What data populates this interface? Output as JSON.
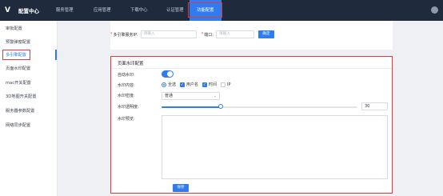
{
  "app": {
    "title": "配置中心"
  },
  "nav": {
    "items": [
      {
        "label": "服务管理"
      },
      {
        "label": "应用管理"
      },
      {
        "label": "下载中心"
      },
      {
        "label": "认证管理"
      },
      {
        "label": "功能配置"
      }
    ]
  },
  "sidebar": {
    "items": [
      {
        "label": "审批配置"
      },
      {
        "label": "预警弹窗配置"
      },
      {
        "label": "多引擎配置"
      },
      {
        "label": "页面水印配置"
      },
      {
        "label": "mac开关配置"
      },
      {
        "label": "3D地图开关配置"
      },
      {
        "label": "服务器参数配置"
      },
      {
        "label": "网络同步配置"
      }
    ]
  },
  "engine_row": {
    "server_label": "多引擎服务IP:",
    "server_placeholder": "请输入",
    "port_label": "端口:",
    "port_placeholder": "请输入",
    "confirm_label": "确定"
  },
  "watermark": {
    "title": "页面水印配置",
    "auto_label": "自动水印:",
    "auto_enabled": true,
    "content_label": "水印内容:",
    "options": [
      {
        "label": "全选",
        "checked": true
      },
      {
        "label": "用户名",
        "checked": true
      },
      {
        "label": "时间",
        "checked": true
      },
      {
        "label": "IP",
        "checked": false
      }
    ],
    "density_label": "水印密度:",
    "density_value": "普通",
    "opacity_label": "水印透明度:",
    "opacity_value": "30",
    "opacity_percent": 30,
    "preview_label": "水印预览:",
    "save_label": "保存"
  },
  "colors": {
    "accent": "#2f7cf0",
    "topbar": "#1f2a3d",
    "highlight": "#e23b3b"
  }
}
